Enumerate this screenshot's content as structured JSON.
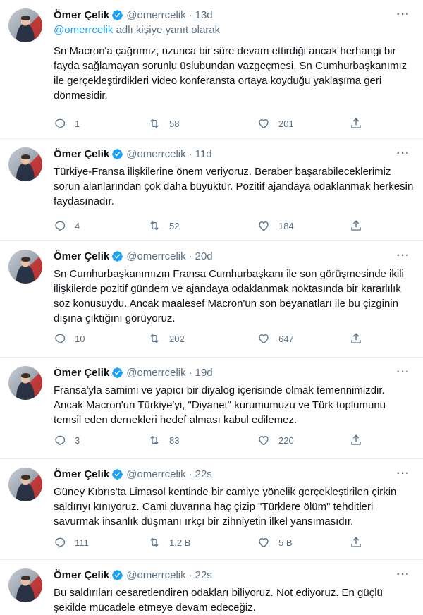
{
  "tweets": [
    {
      "name": "Ömer Çelik",
      "handle": "@omerrcelik",
      "time": "13d",
      "reply_mention": "@omerrcelik",
      "reply_suffix": " adlı kişiye yanıt olarak",
      "text": "Sn Macron'a çağrımız, uzunca bir süre devam ettirdiği ancak herhangi bir fayda sağlamayan sorunlu üslubundan vazgeçmesi, Sn Cumhurbaşkanımız ile gerçekleştirdikleri video konferansta ortaya koyduğu yaklaşıma geri dönmesidir.",
      "replies": "1",
      "retweets": "58",
      "likes": "201"
    },
    {
      "name": "Ömer Çelik",
      "handle": "@omerrcelik",
      "time": "11d",
      "text": "Türkiye-Fransa ilişkilerine önem veriyoruz. Beraber başarabileceklerimiz sorun alanlarından çok daha büyüktür. Pozitif ajandaya odaklanmak herkesin faydasınadır.",
      "replies": "4",
      "retweets": "52",
      "likes": "184"
    },
    {
      "name": "Ömer Çelik",
      "handle": "@omerrcelik",
      "time": "20d",
      "text": "Sn Cumhurbaşkanımızın Fransa Cumhurbaşkanı ile son görüşmesinde ikili ilişkilerde pozitif gündem ve ajandaya odaklanmak noktasında bir kararlılık söz konusuydu. Ancak maalesef Macron'un son beyanatları ile bu çizginin dışına çıktığını görüyoruz.",
      "replies": "10",
      "retweets": "202",
      "likes": "647"
    },
    {
      "name": "Ömer Çelik",
      "handle": "@omerrcelik",
      "time": "19d",
      "text": "Fransa'yla samimi ve yapıcı bir diyalog içerisinde olmak temennimizdir. Ancak Macron'un Türkiye'yi, \"Diyanet\" kurumumuzu ve Türk toplumunu temsil eden dernekleri hedef alması kabul edilemez.",
      "replies": "3",
      "retweets": "83",
      "likes": "220"
    },
    {
      "name": "Ömer Çelik",
      "handle": "@omerrcelik",
      "time": "22s",
      "text": "Güney Kıbrıs'ta Limasol kentinde bir camiye yönelik gerçekleştirilen çirkin saldırıyı kınıyoruz. Cami duvarına haç çizip \"Türklere ölüm\" tehditleri savurmak insanlık düşmanı ırkçı bir zihniyetin ilkel yansımasıdır.",
      "replies": "111",
      "retweets": "1,2 B",
      "likes": "5 B"
    },
    {
      "name": "Ömer Çelik",
      "handle": "@omerrcelik",
      "time": "22s",
      "text": "Bu saldırıları cesaretlendiren odakları biliyoruz. Not ediyoruz. En güçlü şekilde mücadele etmeye devam edeceğiz."
    }
  ],
  "icons": {
    "verified": "verified-badge-icon",
    "more": "more-options-icon",
    "reply": "reply-icon",
    "retweet": "retweet-icon",
    "like": "heart-icon",
    "share": "share-icon"
  },
  "colors": {
    "accent": "#1da1f2",
    "secondary_text": "#5b7083",
    "divider": "#e6ecf0"
  }
}
